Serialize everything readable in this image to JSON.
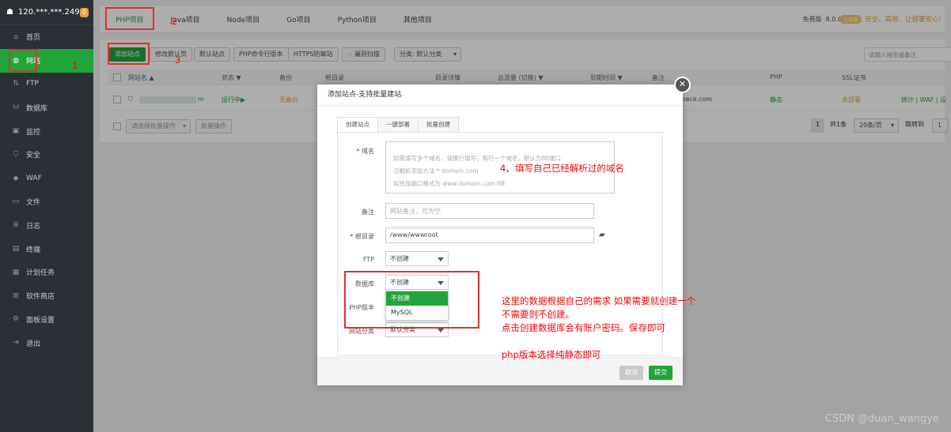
{
  "sidebar": {
    "server_ip": "120.***.***.249",
    "badge": "0",
    "items": [
      {
        "label": "首页",
        "icon": "home-icon",
        "active": false
      },
      {
        "label": "网站",
        "icon": "globe-icon",
        "active": true
      },
      {
        "label": "FTP",
        "icon": "ftp-icon",
        "active": false
      },
      {
        "label": "数据库",
        "icon": "database-icon",
        "active": false
      },
      {
        "label": "监控",
        "icon": "monitor-icon",
        "active": false
      },
      {
        "label": "安全",
        "icon": "shield-icon",
        "active": false
      },
      {
        "label": "WAF",
        "icon": "waf-icon",
        "active": false
      },
      {
        "label": "文件",
        "icon": "folder-icon",
        "active": false
      },
      {
        "label": "日志",
        "icon": "log-icon",
        "active": false
      },
      {
        "label": "终端",
        "icon": "terminal-icon",
        "active": false
      },
      {
        "label": "计划任务",
        "icon": "calendar-icon",
        "active": false
      },
      {
        "label": "软件商店",
        "icon": "apps-icon",
        "active": false
      },
      {
        "label": "面板设置",
        "icon": "settings-icon",
        "active": false
      },
      {
        "label": "退出",
        "icon": "logout-icon",
        "active": false
      }
    ]
  },
  "header": {
    "tabs": [
      "PHP项目",
      "Java项目",
      "Node项目",
      "Go项目",
      "Python项目",
      "其他项目"
    ],
    "edition": "免费版",
    "version": "8.0.0",
    "pro_pill": "企业版",
    "pro_text": "安全、高效、让部署安心!"
  },
  "toolbar": {
    "add_site": "添加站点",
    "modify_default": "修改默认页",
    "default_site": "默认站点",
    "php_cli": "PHP命令行版本",
    "https_waf": "HTTPS防窜站",
    "scan": "漏洞扫描",
    "category": "分类: 默认分类",
    "search_placeholder": "请输入域名或备注"
  },
  "table": {
    "headers": [
      "网站名 ▲",
      "状态 ▼",
      "备份",
      "根目录",
      "目录详情",
      "总流量 (切换) ▼",
      "到期时间 ▼",
      "备注",
      "PHP",
      "SSL证书"
    ],
    "row": {
      "name_suffix": "m",
      "status": "运行中▶",
      "backup": "无备份",
      "remark": "uspace.com",
      "php": "静态",
      "ssl": "未部署",
      "actions": "统计 | WAF | 设"
    },
    "batch_placeholder": "请选择批量操作",
    "batch_button": "批量操作",
    "page": "1",
    "total": "共1条",
    "per_page": "20条/页",
    "jump_label": "跳转到",
    "jump_value": "1"
  },
  "modal": {
    "title": "添加站点-支持批量建站",
    "tabs": [
      "创建站点",
      "一键部署",
      "批量创建"
    ],
    "domain_label": "域名",
    "domain_lines": [
      "如需填写多个域名，请换行填写，每行一个域名，默认为80端口",
      "泛解析添加方法 *.domain.com",
      "如另加端口格式为 www.domain.com:88"
    ],
    "remark_label": "备注",
    "remark_placeholder": "网站备注，可为空",
    "root_label": "根目录",
    "root_value": "/www/wwwroot",
    "ftp_label": "FTP",
    "ftp_value": "不创建",
    "db_label": "数据库",
    "db_value": "不创建",
    "db_options": [
      "不创建",
      "MySQL"
    ],
    "php_label": "PHP版本",
    "category_label": "网站分类",
    "category_value": "默认分类",
    "cancel": "取消",
    "submit": "提交"
  },
  "annotations": {
    "n1": "1",
    "n2": "2",
    "n3": "3",
    "n4": "4、填写自己已经解析过的域名",
    "db_note_1": "这里的数据根据自己的需求 如果需要就创建一个",
    "db_note_2": "不需要则不创建。",
    "db_note_3": "点击创建数据库会有账户密码。保存即可",
    "php_note": "php版本选择纯静态即可"
  },
  "watermark": "CSDN @duan_wangye"
}
